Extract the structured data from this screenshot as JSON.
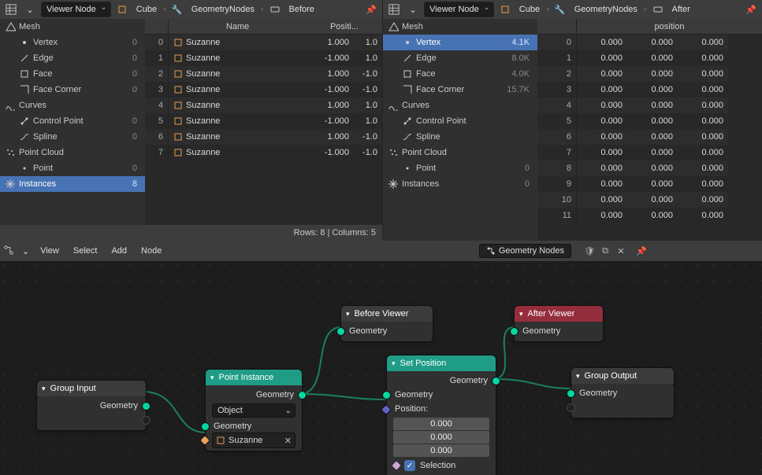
{
  "left": {
    "viewer_label": "Viewer Node",
    "breadcrumb": {
      "obj": "Cube",
      "ng": "GeometryNodes",
      "vn": "Before"
    },
    "tree": [
      {
        "type": "cat",
        "icon": "mesh",
        "label": "Mesh",
        "count": ""
      },
      {
        "type": "itm",
        "icon": "vert",
        "label": "Vertex",
        "count": "0"
      },
      {
        "type": "itm",
        "icon": "edge",
        "label": "Edge",
        "count": "0"
      },
      {
        "type": "itm",
        "icon": "face",
        "label": "Face",
        "count": "0"
      },
      {
        "type": "itm",
        "icon": "fc",
        "label": "Face Corner",
        "count": "0"
      },
      {
        "type": "cat",
        "icon": "curve",
        "label": "Curves",
        "count": ""
      },
      {
        "type": "itm",
        "icon": "cp",
        "label": "Control Point",
        "count": "0"
      },
      {
        "type": "itm",
        "icon": "spl",
        "label": "Spline",
        "count": "0"
      },
      {
        "type": "cat",
        "icon": "pc",
        "label": "Point Cloud",
        "count": ""
      },
      {
        "type": "itm",
        "icon": "pt",
        "label": "Point",
        "count": "0"
      },
      {
        "type": "cat",
        "icon": "ins",
        "label": "Instances",
        "count": "8",
        "selected": true
      }
    ],
    "columns": [
      "",
      "Name",
      "Positi..."
    ],
    "rows": [
      {
        "idx": "0",
        "obj": "Suzanne",
        "vals": [
          "1.000",
          "1.0"
        ]
      },
      {
        "idx": "1",
        "obj": "Suzanne",
        "vals": [
          "-1.000",
          "1.0"
        ]
      },
      {
        "idx": "2",
        "obj": "Suzanne",
        "vals": [
          "1.000",
          "-1.0"
        ]
      },
      {
        "idx": "3",
        "obj": "Suzanne",
        "vals": [
          "-1.000",
          "-1.0"
        ]
      },
      {
        "idx": "4",
        "obj": "Suzanne",
        "vals": [
          "1.000",
          "1.0"
        ]
      },
      {
        "idx": "5",
        "obj": "Suzanne",
        "vals": [
          "-1.000",
          "1.0"
        ]
      },
      {
        "idx": "6",
        "obj": "Suzanne",
        "vals": [
          "1.000",
          "-1.0"
        ]
      },
      {
        "idx": "7",
        "obj": "Suzanne",
        "vals": [
          "-1.000",
          "-1.0"
        ]
      }
    ],
    "footer": "Rows: 8   |   Columns: 5"
  },
  "right": {
    "viewer_label": "Viewer Node",
    "breadcrumb": {
      "obj": "Cube",
      "ng": "GeometryNodes",
      "vn": "After"
    },
    "tree": [
      {
        "type": "cat",
        "icon": "mesh",
        "label": "Mesh",
        "count": ""
      },
      {
        "type": "itm",
        "icon": "vert",
        "label": "Vertex",
        "count": "4.1K",
        "selected": true
      },
      {
        "type": "itm",
        "icon": "edge",
        "label": "Edge",
        "count": "8.0K"
      },
      {
        "type": "itm",
        "icon": "face",
        "label": "Face",
        "count": "4.0K"
      },
      {
        "type": "itm",
        "icon": "fc",
        "label": "Face Corner",
        "count": "15.7K"
      },
      {
        "type": "cat",
        "icon": "curve",
        "label": "Curves",
        "count": ""
      },
      {
        "type": "itm",
        "icon": "cp",
        "label": "Control Point",
        "count": ""
      },
      {
        "type": "itm",
        "icon": "spl",
        "label": "Spline",
        "count": ""
      },
      {
        "type": "cat",
        "icon": "pc",
        "label": "Point Cloud",
        "count": ""
      },
      {
        "type": "itm",
        "icon": "pt",
        "label": "Point",
        "count": "0"
      },
      {
        "type": "cat",
        "icon": "ins",
        "label": "Instances",
        "count": "0"
      }
    ],
    "columns": [
      "",
      "position",
      "",
      ""
    ],
    "rows": [
      {
        "idx": "0",
        "vals": [
          "0.000",
          "0.000",
          "0.000"
        ]
      },
      {
        "idx": "1",
        "vals": [
          "0.000",
          "0.000",
          "0.000"
        ]
      },
      {
        "idx": "2",
        "vals": [
          "0.000",
          "0.000",
          "0.000"
        ]
      },
      {
        "idx": "3",
        "vals": [
          "0.000",
          "0.000",
          "0.000"
        ]
      },
      {
        "idx": "4",
        "vals": [
          "0.000",
          "0.000",
          "0.000"
        ]
      },
      {
        "idx": "5",
        "vals": [
          "0.000",
          "0.000",
          "0.000"
        ]
      },
      {
        "idx": "6",
        "vals": [
          "0.000",
          "0.000",
          "0.000"
        ]
      },
      {
        "idx": "7",
        "vals": [
          "0.000",
          "0.000",
          "0.000"
        ]
      },
      {
        "idx": "8",
        "vals": [
          "0.000",
          "0.000",
          "0.000"
        ]
      },
      {
        "idx": "9",
        "vals": [
          "0.000",
          "0.000",
          "0.000"
        ]
      },
      {
        "idx": "10",
        "vals": [
          "0.000",
          "0.000",
          "0.000"
        ]
      },
      {
        "idx": "11",
        "vals": [
          "0.000",
          "0.000",
          "0.000"
        ]
      }
    ]
  },
  "editor": {
    "menus": [
      "View",
      "Select",
      "Add",
      "Node"
    ],
    "ng_name": "Geometry Nodes",
    "nodes": {
      "group_input": {
        "title": "Group Input",
        "out": "Geometry"
      },
      "point_instance": {
        "title": "Point Instance",
        "out": "Geometry",
        "in_geom": "Geometry",
        "mode": "Object",
        "object": "Suzanne"
      },
      "before_viewer": {
        "title": "Before Viewer",
        "in": "Geometry"
      },
      "set_position": {
        "title": "Set Position",
        "out": "Geometry",
        "in_geom": "Geometry",
        "pos_label": "Position:",
        "pos": [
          "0.000",
          "0.000",
          "0.000"
        ],
        "sel": "Selection"
      },
      "after_viewer": {
        "title": "After Viewer",
        "in": "Geometry"
      },
      "group_output": {
        "title": "Group Output",
        "in": "Geometry"
      }
    }
  }
}
